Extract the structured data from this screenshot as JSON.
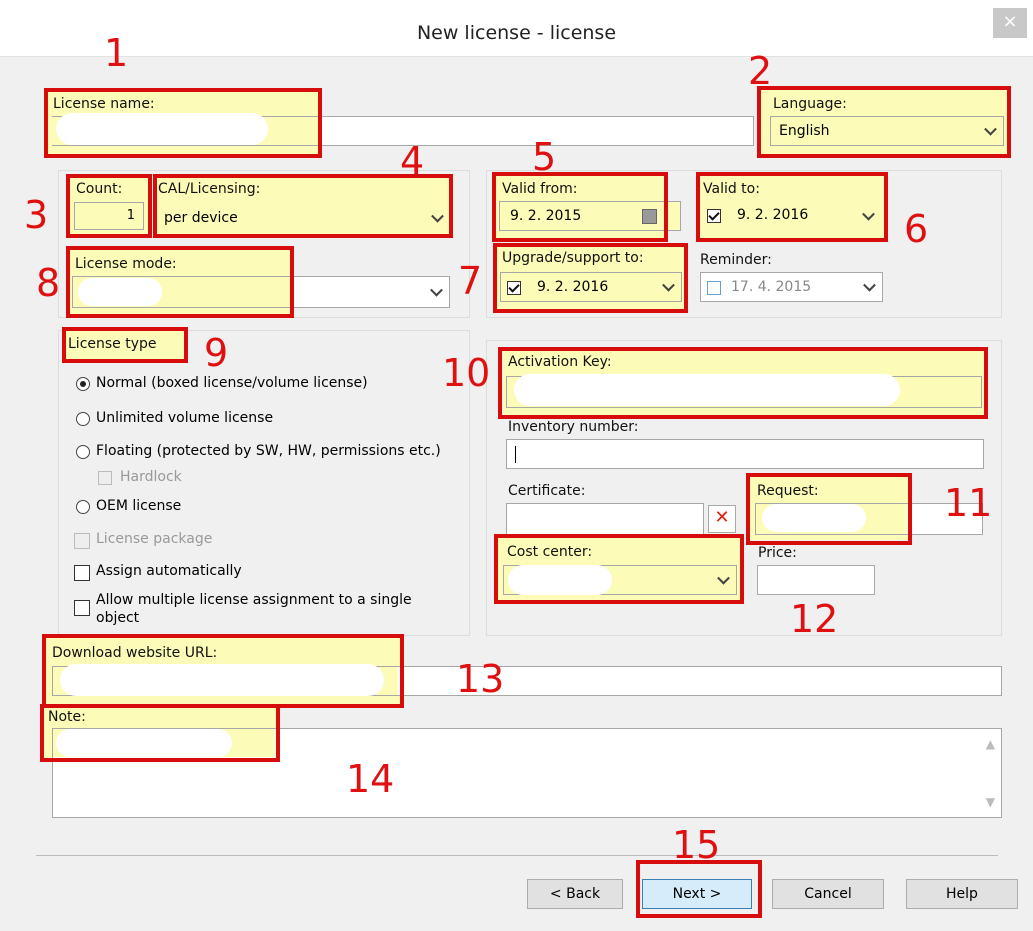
{
  "window": {
    "title": "New license - license",
    "close_glyph": "×"
  },
  "fields": {
    "license_name": "License name:",
    "language": "Language:",
    "language_value": "English",
    "count": "Count:",
    "count_value": "1",
    "cal_licensing": "CAL/Licensing:",
    "cal_value": "per device",
    "license_mode": "License mode:",
    "valid_from": "Valid from:",
    "valid_from_value": "9.  2. 2015",
    "valid_to": "Valid to:",
    "valid_to_value": "9.  2. 2016",
    "upgrade_support": "Upgrade/support to:",
    "upgrade_value": "9.  2. 2016",
    "reminder": "Reminder:",
    "reminder_value": "17.  4. 2015",
    "activation_key": "Activation Key:",
    "inventory_number": "Inventory number:",
    "certificate": "Certificate:",
    "request": "Request:",
    "cost_center": "Cost center:",
    "price": "Price:",
    "download_url": "Download website URL:",
    "note": "Note:"
  },
  "license_type": {
    "title": "License type",
    "normal": "Normal (boxed license/volume license)",
    "unlimited": "Unlimited volume license",
    "floating": "Floating (protected by SW, HW, permissions etc.)",
    "hardlock": "Hardlock",
    "oem": "OEM license",
    "package": "License package",
    "assign_auto": "Assign automatically",
    "allow_multi_1": "Allow multiple license assignment to a single",
    "allow_multi_2": "object"
  },
  "buttons": {
    "back": "< Back",
    "next": "Next >",
    "cancel": "Cancel",
    "help": "Help"
  },
  "annotations": [
    "1",
    "2",
    "3",
    "4",
    "5",
    "6",
    "7",
    "8",
    "9",
    "10",
    "11",
    "12",
    "13",
    "14",
    "15"
  ],
  "colors": {
    "highlight": "#fdfbb8",
    "annotation_red": "#d70c0c"
  },
  "icons": {
    "calendar": "calendar-icon",
    "remove": "remove-x-icon",
    "dropdown": "chevron-down-icon"
  }
}
